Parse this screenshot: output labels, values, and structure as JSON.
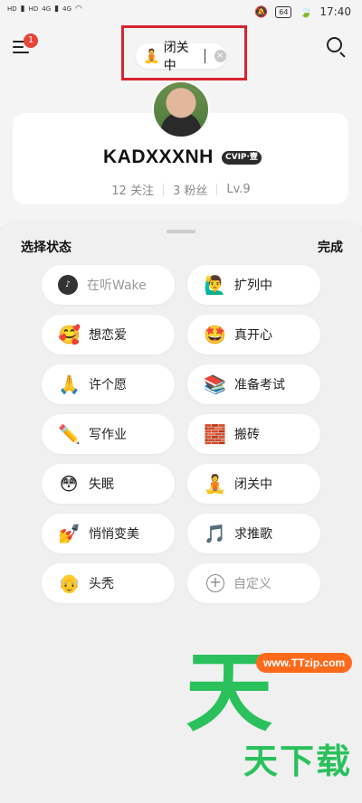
{
  "status_bar": {
    "left_labels": [
      "HD",
      "HD",
      "4G",
      "4G"
    ],
    "battery": "64",
    "time": "17:40"
  },
  "header": {
    "menu_badge": "1",
    "current_status": {
      "emoji": "🧘",
      "label": "闭关中",
      "clear_icon": "×"
    }
  },
  "profile": {
    "username": "KADXXXNH",
    "vip_badge": "CVIP·壹",
    "stats": [
      "12 关注",
      "3 粉丝",
      "Lv.9"
    ]
  },
  "status_sheet": {
    "title": "选择状态",
    "done_label": "完成",
    "options": [
      {
        "emoji": "Wake",
        "label": "在听Wake",
        "muted": true
      },
      {
        "emoji": "🙋‍♂️",
        "label": "扩列中"
      },
      {
        "emoji": "🥰",
        "label": "想恋爱"
      },
      {
        "emoji": "🤩",
        "label": "真开心"
      },
      {
        "emoji": "🙏",
        "label": "许个愿"
      },
      {
        "emoji": "📚",
        "label": "准备考试"
      },
      {
        "emoji": "✏️",
        "label": "写作业"
      },
      {
        "emoji": "🧱",
        "label": "搬砖"
      },
      {
        "emoji": "😳",
        "label": "失眠"
      },
      {
        "emoji": "🧘",
        "label": "闭关中"
      },
      {
        "emoji": "💅",
        "label": "悄悄变美"
      },
      {
        "emoji": "🎵",
        "label": "求推歌"
      },
      {
        "emoji": "👴",
        "label": "头秃"
      },
      {
        "emoji": "+",
        "label": "自定义",
        "muted": true
      }
    ]
  },
  "watermark": {
    "logo_char": "天",
    "url": "www.TTzip.com",
    "text": "天下载"
  }
}
